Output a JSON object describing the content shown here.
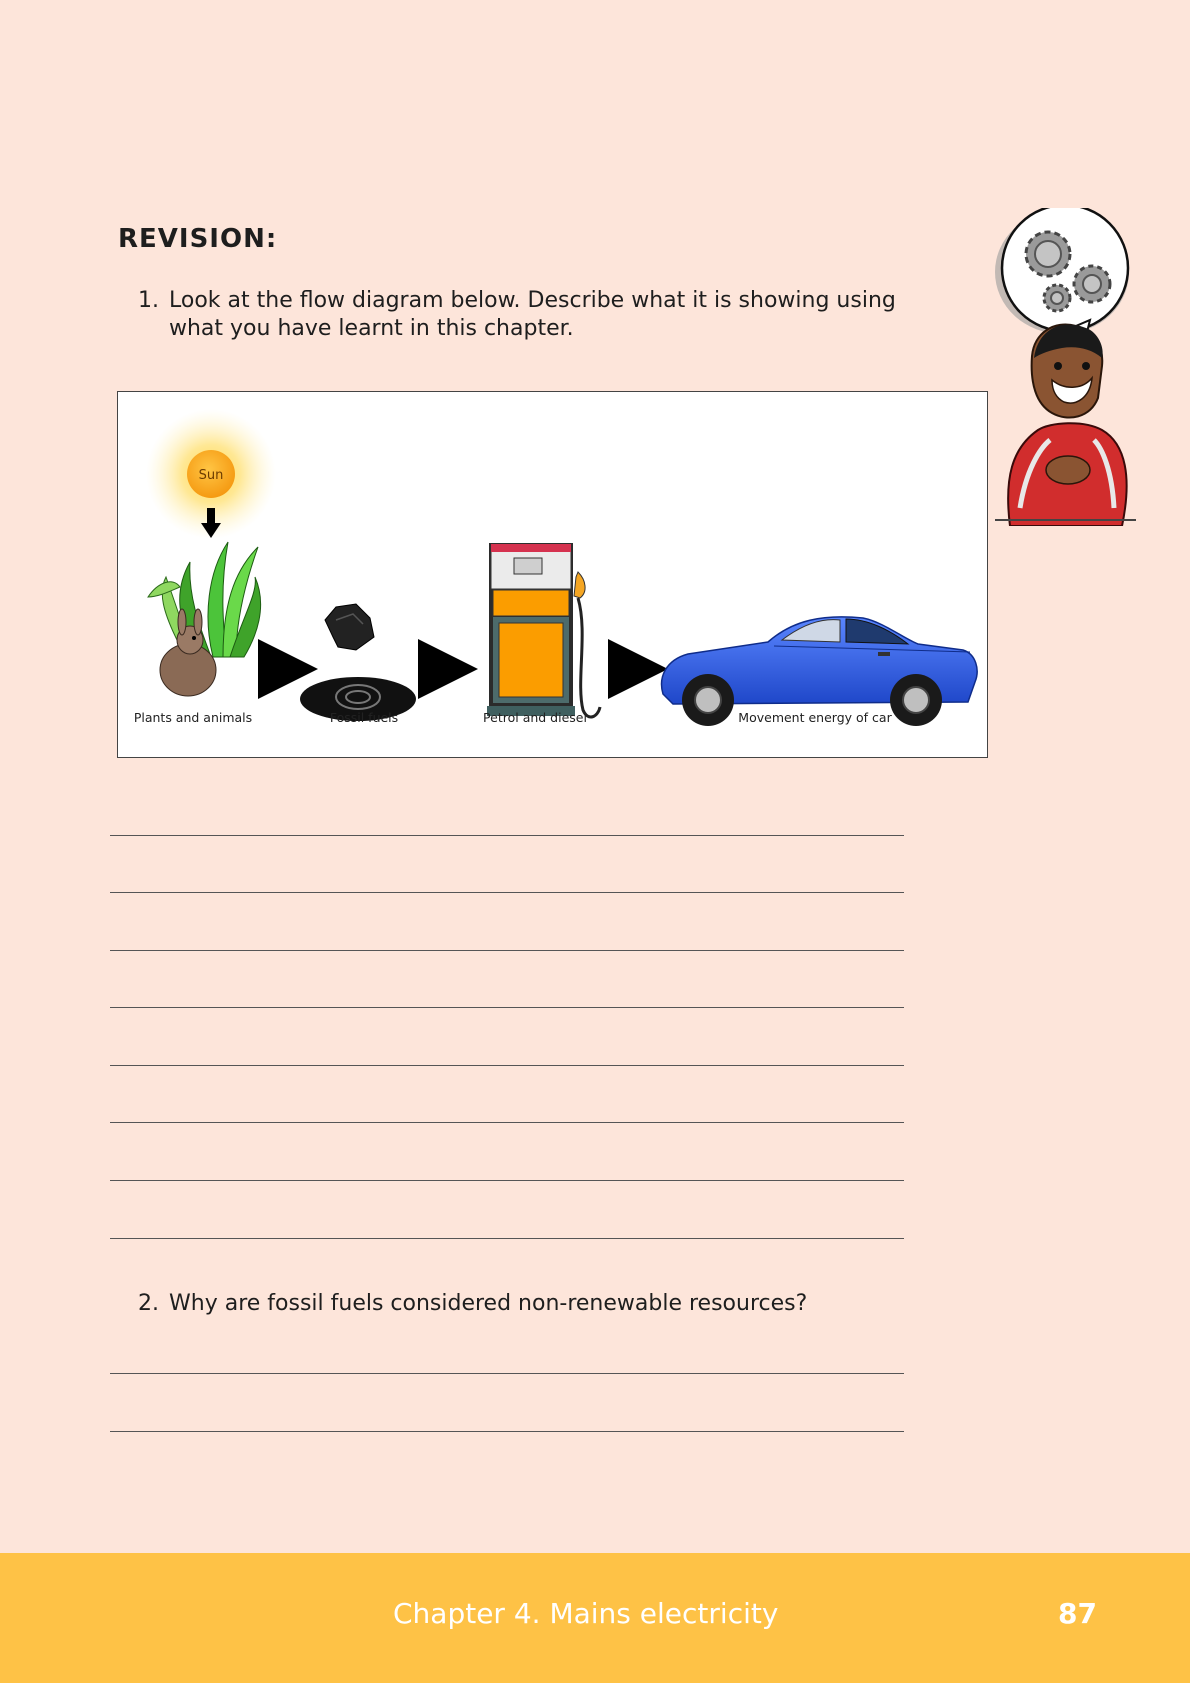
{
  "revision": {
    "heading": "REVISION:",
    "questions": [
      {
        "number": "1.",
        "text": "Look at the flow diagram below. Describe what it is showing using what you have learnt in this chapter."
      },
      {
        "number": "2.",
        "text": "Why are fossil fuels considered non-renewable resources?"
      }
    ]
  },
  "diagram": {
    "sun_label": "Sun",
    "stages": [
      "Plants and animals",
      "Fossil fuels",
      "Petrol and diesel",
      "Movement energy of car"
    ]
  },
  "footer": {
    "chapter": "Chapter 4.   Mains electricity",
    "page_number": "87"
  },
  "colors": {
    "page_background": "#fde5da",
    "footer_background": "#fec246",
    "footer_text": "#ffffff",
    "pump_body": "#fb9d00",
    "car_body": "#2f5de0"
  }
}
